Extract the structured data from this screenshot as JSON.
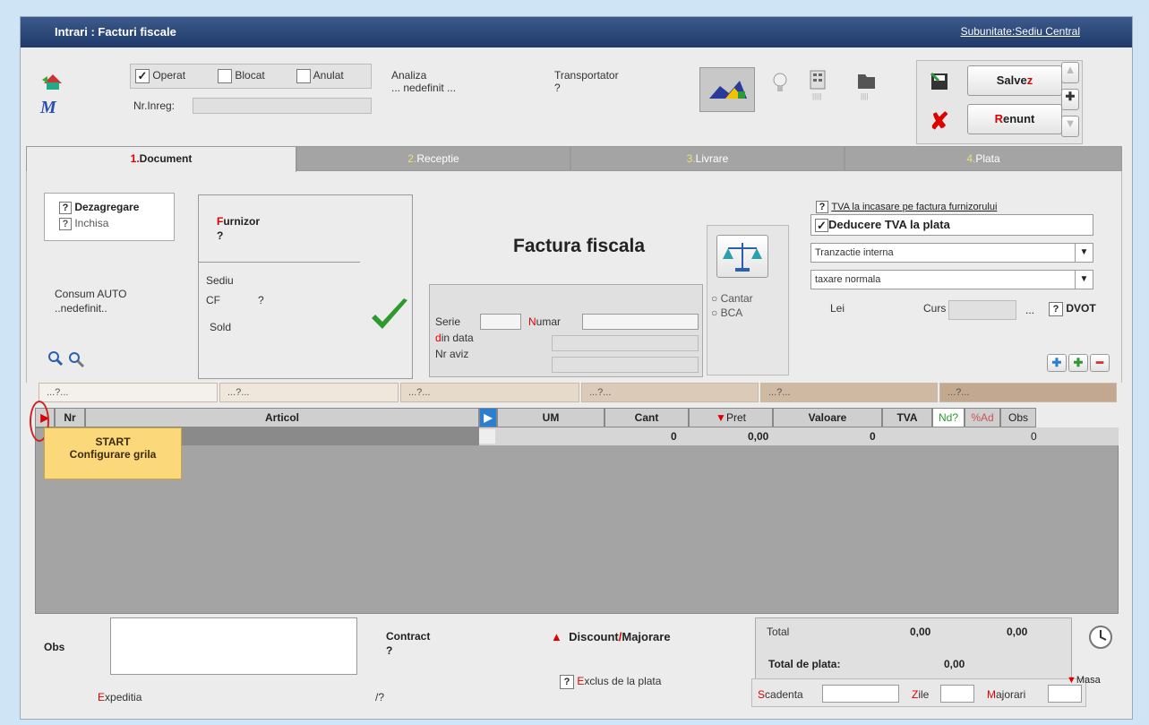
{
  "window": {
    "title": "Intrari : Facturi fiscale",
    "subunit": "Subunitate:Sediu Central"
  },
  "status": {
    "operat": "Operat",
    "blocat": "Blocat",
    "anulat": "Anulat",
    "nr_inreg": "Nr.Inreg:"
  },
  "analiza": {
    "label": "Analiza",
    "value": "... nedefinit ..."
  },
  "transportator": {
    "label": "Transportator",
    "value": "?"
  },
  "actions": {
    "save": "Salvez",
    "save_accent": "z",
    "cancel": "Renunt",
    "cancel_accent": "R"
  },
  "tabs": [
    {
      "num": "1.",
      "label": "Document"
    },
    {
      "num": "2.",
      "label": "Receptie"
    },
    {
      "num": "3.",
      "label": "Livrare"
    },
    {
      "num": "4.",
      "label": "Plata"
    }
  ],
  "dezagregare": {
    "q1": "?",
    "l1": "Dezagregare",
    "q2": "?",
    "l2": "Inchisa"
  },
  "furnizor": {
    "label": "Furnizor",
    "first": "F",
    "rest": "urnizor",
    "value": "?",
    "sediu": "Sediu",
    "cf": "CF",
    "cf_val": "?",
    "sold": "Sold"
  },
  "consum": {
    "label": "Consum AUTO",
    "value": "..nedefinit.."
  },
  "doc": {
    "title": "Factura fiscala",
    "serie": "Serie",
    "numar": "Numar",
    "numar_first": "N",
    "numar_rest": "umar",
    "din_data": "din data",
    "din_first": "d",
    "din_rest": "in data",
    "nr_aviz": "Nr aviz",
    "cantar": "Cantar",
    "bca": "BCA"
  },
  "tva": {
    "q": "?",
    "incasare": "TVA la incasare pe factura furnizorului",
    "deducere": "Deducere TVA la plata",
    "tranzactie": "Tranzactie interna",
    "taxare": "taxare normala",
    "lei": "Lei",
    "curs": "Curs",
    "dots": "...",
    "dvot_q": "?",
    "dvot": "DVOT"
  },
  "filters": [
    "...?...",
    "...?...",
    "...?...",
    "...?...",
    "...?...",
    "...?..."
  ],
  "grid": {
    "columns": {
      "nr": "Nr",
      "articol": "Articol",
      "um": "UM",
      "cant": "Cant",
      "pret": "Pret",
      "valoare": "Valoare",
      "tva": "TVA",
      "nd": "Nd?",
      "ad": "%Ad",
      "obs": "Obs"
    },
    "row": {
      "cant": "0",
      "pret": "0,00",
      "valoare": "0",
      "ad": "0"
    }
  },
  "tooltip": {
    "line1": "START",
    "line2": "Configurare grila"
  },
  "bottom": {
    "obs": "Obs",
    "contract": "Contract",
    "contract_val": "?",
    "discount": "Discount",
    "slash": "/",
    "majorare": "Majorare",
    "expeditia": "Expeditia",
    "expeditia_first": "E",
    "expeditia_rest": "xpeditia",
    "expeditia_val": "/?",
    "exclus_q": "?",
    "exclus": "Exclus de la plata",
    "exclus_first": "E",
    "exclus_rest": "xclus de la plata"
  },
  "totals": {
    "total": "Total",
    "v1": "0,00",
    "v2": "0,00",
    "total_plata": "Total de plata:",
    "tp_val": "0,00",
    "masa": "Masa",
    "scadenta": "Scadenta",
    "scad_first": "S",
    "scad_rest": "cadenta",
    "zile": "Zile",
    "zile_first": "Z",
    "zile_rest": "ile",
    "majorari": "Majorari",
    "maj_first": "M",
    "maj_rest": "ajorari"
  },
  "colors": {
    "title_bg": "#1f3a6a",
    "accent_red": "#dd0000",
    "tooltip_bg": "#fbd97a"
  }
}
